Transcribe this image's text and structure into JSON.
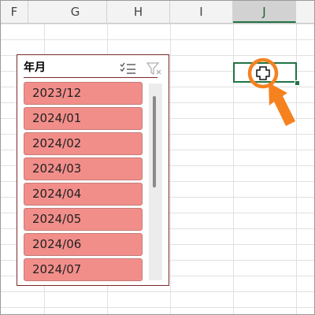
{
  "columns": [
    {
      "id": "F",
      "label": "F"
    },
    {
      "id": "G",
      "label": "G"
    },
    {
      "id": "H",
      "label": "H"
    },
    {
      "id": "I",
      "label": "I"
    },
    {
      "id": "J",
      "label": "J",
      "selected": true
    }
  ],
  "active_cell": "J",
  "slicer": {
    "title": "年月",
    "multiselect_icon": "multi-select-icon",
    "clear_filter_icon": "clear-filter-icon",
    "items": [
      {
        "label": "2023/12"
      },
      {
        "label": "2024/01"
      },
      {
        "label": "2024/02"
      },
      {
        "label": "2024/03"
      },
      {
        "label": "2024/04"
      },
      {
        "label": "2024/05"
      },
      {
        "label": "2024/06"
      },
      {
        "label": "2024/07"
      }
    ]
  },
  "colors": {
    "item_fill": "#f28e8a",
    "slicer_border": "#7a2a2a",
    "selection_green": "#217346",
    "callout_orange": "#f5821f"
  },
  "overlay": {
    "cursor_icon": "cell-select-cursor-icon",
    "arrow_icon": "orange-arrow-icon"
  }
}
